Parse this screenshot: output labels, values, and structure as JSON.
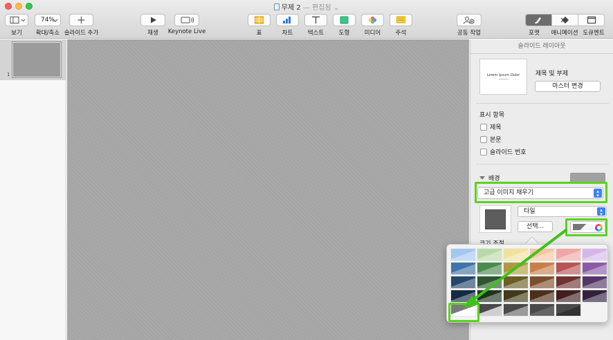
{
  "window": {
    "title": "무제 2",
    "subtitle": "— 편집됨",
    "subtitle_chevron": "⌄"
  },
  "toolbar": {
    "view": {
      "label": "보기",
      "icon": "sidebar-view-icon"
    },
    "zoom": {
      "label": "확대/축소",
      "value": "74%"
    },
    "add_slide": {
      "label": "슬라이드 추가",
      "icon": "plus-icon"
    },
    "play": {
      "label": "재생",
      "icon": "play-icon"
    },
    "keynote_live": {
      "label": "Keynote Live",
      "icon": "keynote-live-icon"
    },
    "table": {
      "label": "표",
      "icon": "table-icon"
    },
    "chart": {
      "label": "차트",
      "icon": "chart-icon"
    },
    "text": {
      "label": "텍스트",
      "icon": "text-icon"
    },
    "shape": {
      "label": "도형",
      "icon": "shape-icon"
    },
    "media": {
      "label": "미디어",
      "icon": "media-icon"
    },
    "comment": {
      "label": "주석",
      "icon": "comment-icon"
    },
    "collaborate": {
      "label": "공동 작업",
      "icon": "collaborate-icon"
    },
    "format": {
      "label": "포맷",
      "icon": "paintbrush-icon"
    },
    "animate": {
      "label": "애니메이션",
      "icon": "animate-icon"
    },
    "document": {
      "label": "도큐멘트",
      "icon": "document-icon"
    }
  },
  "navigator": {
    "slides": [
      {
        "number": "1"
      }
    ]
  },
  "inspector": {
    "header": "슬라이드 레이아웃",
    "layout_thumb_text": "Lorem Ipsum Dolor",
    "layout_name": "제목 및 부제",
    "change_master": "마스터 변경",
    "appearance_title": "표시 항목",
    "checkboxes": [
      {
        "label": "제목",
        "checked": false
      },
      {
        "label": "본문",
        "checked": false
      },
      {
        "label": "슬라이드 번호",
        "checked": false
      }
    ],
    "background_title": "배경",
    "fill_type": "고급 이미지 채우기",
    "scale_mode": "타일",
    "choose_button": "선택...",
    "size_label": "크기 조절"
  },
  "colors": {
    "highlight": "#5ad41e",
    "accent": "#3b82f6",
    "canvas": "#a7a7a7"
  },
  "tint_palette": {
    "rows": [
      [
        "#a3c8ef",
        "#b9daa8",
        "#f2e29b",
        "#f6c59d",
        "#f1a6a6",
        "#d6b6e8"
      ],
      [
        "#3f74a8",
        "#4a8a4e",
        "#b09a3d",
        "#c97e4a",
        "#b75454",
        "#8a5aa7"
      ],
      [
        "#25466b",
        "#2c5530",
        "#6c5d25",
        "#7d4e2e",
        "#6e3232",
        "#533665"
      ],
      [
        "#152a42",
        "#1b351e",
        "#423a18",
        "#4d301c",
        "#441f1f",
        "#33213f"
      ],
      [
        "#ffffff",
        "#cfcfcf",
        "#9a9a9a",
        "#666666",
        "#333333",
        null
      ]
    ],
    "selected": {
      "row": 4,
      "col": 0
    }
  }
}
